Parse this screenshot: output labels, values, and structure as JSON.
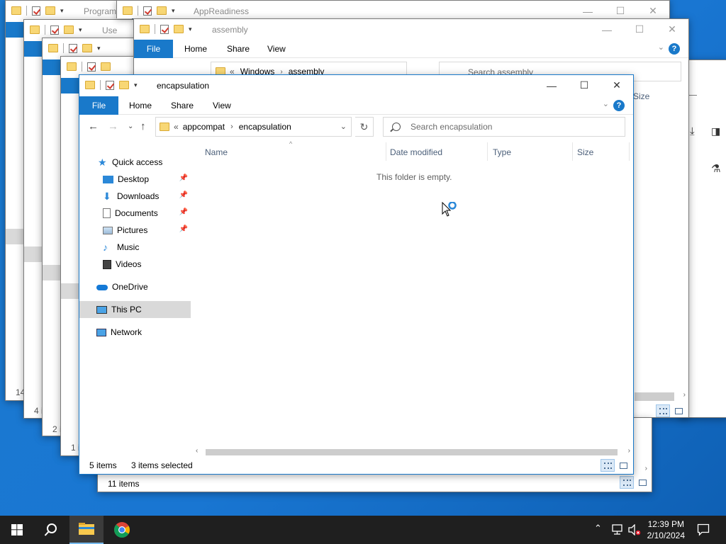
{
  "background_windows": [
    {
      "title": "Program",
      "status": "14"
    },
    {
      "title": "Use",
      "status": "4 i"
    },
    {
      "title": "",
      "status": "2 i"
    },
    {
      "title": "",
      "status": "1 i"
    },
    {
      "title": "AppReadiness",
      "status": ""
    },
    {
      "title": "assembly",
      "status": "11 items",
      "address": [
        "Windows",
        "assembly"
      ],
      "search_placeholder": "Search assembly",
      "col_size": "Size"
    }
  ],
  "main_window": {
    "title": "encapsulation",
    "ribbon": {
      "file": "File",
      "home": "Home",
      "share": "Share",
      "view": "View",
      "help": "?"
    },
    "address": {
      "overflow": "«",
      "crumbs": [
        "appcompat",
        "encapsulation"
      ]
    },
    "search_placeholder": "Search encapsulation",
    "nav": [
      {
        "label": "Quick access",
        "icon": "star-icon",
        "pinned": false
      },
      {
        "label": "Desktop",
        "icon": "desktop-icon",
        "pinned": true
      },
      {
        "label": "Downloads",
        "icon": "downloads-icon",
        "pinned": true
      },
      {
        "label": "Documents",
        "icon": "documents-icon",
        "pinned": true
      },
      {
        "label": "Pictures",
        "icon": "pictures-icon",
        "pinned": true
      },
      {
        "label": "Music",
        "icon": "music-icon",
        "pinned": false
      },
      {
        "label": "Videos",
        "icon": "videos-icon",
        "pinned": false
      },
      {
        "label": "OneDrive",
        "icon": "onedrive-icon",
        "pinned": false
      },
      {
        "label": "This PC",
        "icon": "this-pc-icon",
        "pinned": false,
        "selected": true
      },
      {
        "label": "Network",
        "icon": "network-icon",
        "pinned": false
      }
    ],
    "columns": [
      "Name",
      "Date modified",
      "Type",
      "Size"
    ],
    "empty_message": "This folder is empty.",
    "status": {
      "items": "5 items",
      "selected": "3 items selected"
    }
  },
  "taskbar": {
    "time": "12:39 PM",
    "date": "2/10/2024",
    "accent": "#76b9ed"
  }
}
